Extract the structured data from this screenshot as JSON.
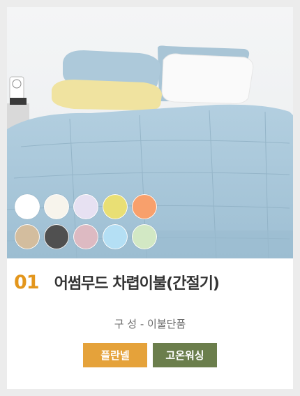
{
  "product": {
    "number": "01",
    "name": "어썸무드 차렵이불(간절기)",
    "composition": "구 성 - 이불단품"
  },
  "badges": [
    {
      "label": "플란넬",
      "color": "#e5a23a"
    },
    {
      "label": "고온워싱",
      "color": "#6b7e4c"
    }
  ],
  "color_options": [
    {
      "name": "white",
      "color": "#ffffff"
    },
    {
      "name": "ivory",
      "color": "#f7f4ec"
    },
    {
      "name": "lavender",
      "color": "#e7e1f2"
    },
    {
      "name": "yellow",
      "color": "#e9df74"
    },
    {
      "name": "orange",
      "color": "#f8a06c"
    },
    {
      "name": "beige",
      "color": "#d3bd9e"
    },
    {
      "name": "charcoal",
      "color": "#505050"
    },
    {
      "name": "pink",
      "color": "#ddbac2"
    },
    {
      "name": "sky-blue",
      "color": "#b4dff4"
    },
    {
      "name": "mint",
      "color": "#d2e8c4"
    }
  ],
  "photo": {
    "subject": "bedding",
    "colors": {
      "wall": "#f1f3f4",
      "blanket": "#a8c6d8",
      "pillow_yellow": "#f0e3a0",
      "pillow_white": "#fafafa"
    }
  }
}
